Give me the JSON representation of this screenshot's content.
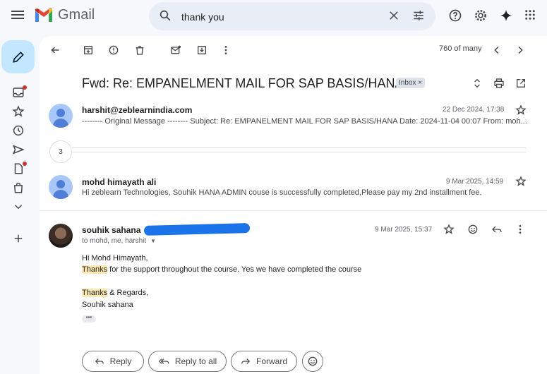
{
  "app": {
    "name": "Gmail"
  },
  "search": {
    "value": "thank you",
    "placeholder": "Search mail"
  },
  "toolbar": {
    "count": "760 of many"
  },
  "thread": {
    "subject": "Fwd: Re: EMPANELMENT MAIL FOR SAP BASIS/HANA",
    "label_chip": "Inbox",
    "label_chip_close": "×",
    "collapsed_count": "3"
  },
  "messages": [
    {
      "sender": "harshit@zeblearnindia.com",
      "date": "22 Dec 2024, 17:38",
      "snippet": "-------- Original Message -------- Subject: Re: EMPANELMENT MAIL FOR SAP BASIS/HANA Date: 2024-11-04 00:07 From: moh..."
    },
    {
      "sender": "mohd himayath ali",
      "date": "9 Mar 2025, 14:59",
      "snippet": "Hi zeblearn Technologies, Souhik HANA ADMIN couse is successfully completed,Please pay my 2nd installment fee."
    },
    {
      "sender": "souhik sahana",
      "date": "9 Mar 2025, 15:37",
      "to_line": "to mohd, me, harshit",
      "body": {
        "greeting": "Hi Mohd Himayath,",
        "line1_highlight": "Thanks",
        "line1_rest": " for the support throughout the course. Yes we have completed the course",
        "sign_highlight": "Thanks",
        "sign_rest": " & Regards,",
        "name": "Souhik sahana"
      }
    }
  ],
  "actions": {
    "reply": "Reply",
    "reply_all": "Reply to all",
    "forward": "Forward"
  },
  "colors": {
    "accent": "#1a73e8",
    "compose": "#c2e7ff",
    "highlight": "#fce8b2",
    "badge": "#d93025"
  }
}
